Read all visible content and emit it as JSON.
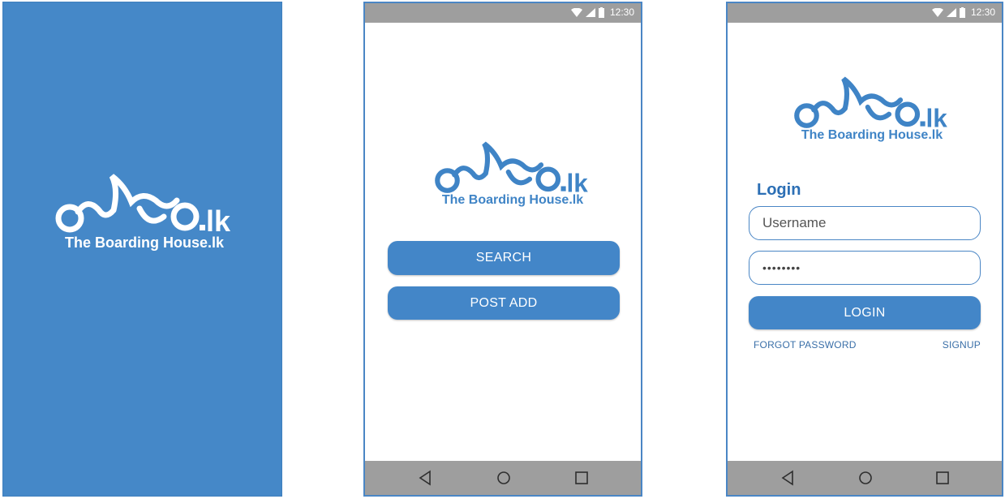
{
  "splash": {
    "logo_script": "බෝඩිම.lk",
    "logo_tagline": "The Boarding House.lk"
  },
  "home": {
    "status_time": "12:30",
    "logo_script": "බෝඩිම.lk",
    "logo_tagline": "The Boarding House.lk",
    "search_label": "SEARCH",
    "post_add_label": "POST ADD"
  },
  "login": {
    "status_time": "12:30",
    "logo_script": "බෝඩිම.lk",
    "logo_tagline": "The Boarding House.lk",
    "title": "Login",
    "username_placeholder": "Username",
    "password_value": "••••••••",
    "login_label": "LOGIN",
    "forgot_label": "FORGOT PASSWORD",
    "signup_label": "SIGNUP"
  },
  "colors": {
    "brand_blue": "#4386c8",
    "status_gray": "#9e9e9e"
  },
  "icons": [
    "wifi-icon",
    "signal-icon",
    "battery-icon",
    "back-icon",
    "home-icon",
    "recents-icon"
  ]
}
